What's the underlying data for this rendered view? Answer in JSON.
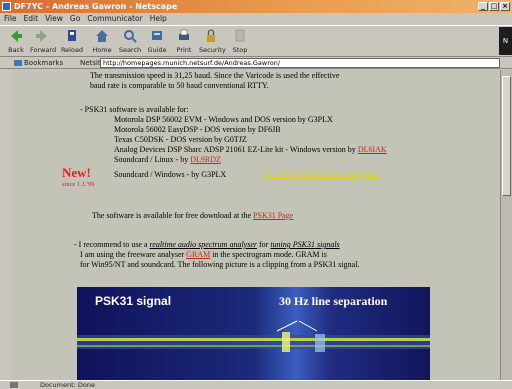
{
  "window": {
    "title": "DF7YC - Andreas Gawron - Netscape"
  },
  "menubar": {
    "items": [
      "File",
      "Edit",
      "View",
      "Go",
      "Communicator",
      "Help"
    ]
  },
  "toolbar": {
    "buttons": [
      "Back",
      "Forward",
      "Reload",
      "Home",
      "Search",
      "Guide",
      "Print",
      "Security",
      "Stop"
    ]
  },
  "location": {
    "bookmarks_label": "Bookmarks",
    "netsite_label": "Netsite:",
    "url": "http://homepages.munich.netsurf.de/Andreas.Gawron/"
  },
  "content": {
    "intro1": "The transmission speed is 31,25 baud. Since the Varicode is used the effective",
    "intro2": "baud rate is comparable to 50 baud conventional RTTY.",
    "software_heading": "- PSK31 software is available for:",
    "sw1": "Motorola DSP 56002 EVM - Windows and DOS version by G3PLX",
    "sw2": "Motorola 56002 EasyDSP - DOS version by DF6JB",
    "sw3": "Texas C50DSK - DOS version by G0TJZ",
    "sw4_text": "Analog Devices DSP Sharc ADSP 21061 EZ-Lite kit - Windows version by",
    "sw4_link": "DL6IAK",
    "sw5_text": "Soundcard / Linux - by",
    "sw5_link": "DL9RDZ",
    "new_badge": "New!",
    "new_since": "since 1.1.'99",
    "sw6_text": "Soundcard / Windows - by G3PLX",
    "sw6_link": "V. 1.03 with spectrum analyser !",
    "download_text": "The software is available for free download at the",
    "download_link": "PSK31 Page",
    "rec_prefix": "- I recommend to use a",
    "rec_link1": "realtime audio spectrum analyser",
    "rec_mid": "for",
    "rec_link2": "tuning PSK31 signals",
    "rec2_text": "I am using the freeware analyser",
    "rec2_link": "GRAM",
    "rec2_rest": "in the spectrogram mode. GRAM is",
    "rec3": "for Win95/NT and soundcard. The following picture is a clipping from a PSK31 signal."
  },
  "spectrogram": {
    "label_left": "PSK31 signal",
    "label_right": "30 Hz line separation"
  },
  "statusbar": {
    "text": "Document: Done"
  }
}
